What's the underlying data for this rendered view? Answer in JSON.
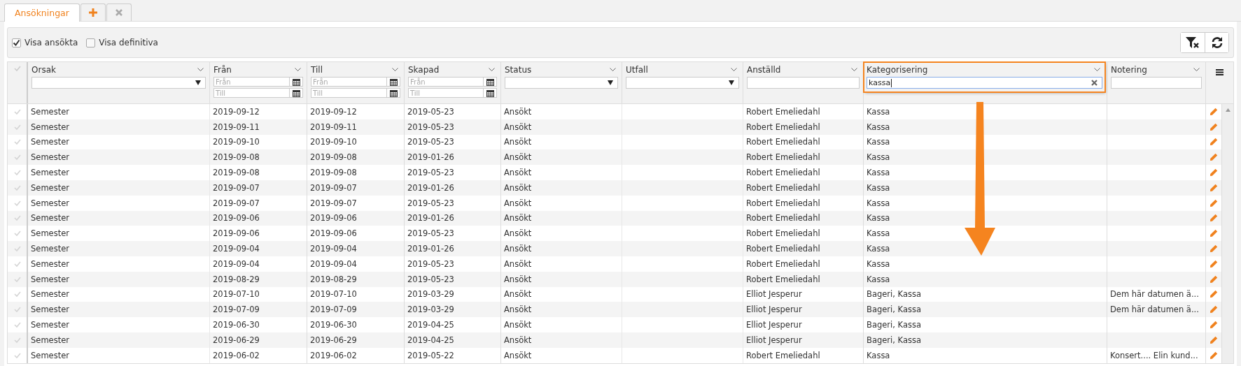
{
  "tabs": [
    {
      "label": "Ansökningar",
      "selected": true
    }
  ],
  "toolbar": {
    "checkboxes": [
      {
        "label": "Visa ansökta",
        "checked": true
      },
      {
        "label": "Visa definitiva",
        "checked": false
      }
    ]
  },
  "columns": [
    {
      "title": "Orsak",
      "filter": {
        "kind": "select"
      }
    },
    {
      "title": "Från",
      "filter": {
        "kind": "daterange",
        "from_placeholder": "Från",
        "to_placeholder": "Till"
      }
    },
    {
      "title": "Till",
      "filter": {
        "kind": "daterange",
        "from_placeholder": "Från",
        "to_placeholder": "Till"
      }
    },
    {
      "title": "Skapad",
      "filter": {
        "kind": "daterange",
        "from_placeholder": "Från",
        "to_placeholder": "Till"
      }
    },
    {
      "title": "Status",
      "filter": {
        "kind": "select"
      }
    },
    {
      "title": "Utfall",
      "filter": {
        "kind": "select"
      }
    },
    {
      "title": "Anställd",
      "filter": {
        "kind": "text"
      }
    },
    {
      "title": "Kategorisering",
      "highlighted": true,
      "filter": {
        "kind": "text",
        "value": "kassa"
      }
    },
    {
      "title": "Notering",
      "filter": {
        "kind": "text"
      }
    }
  ],
  "rows": [
    {
      "orsak": "Semester",
      "fran": "2019-09-12",
      "till": "2019-09-12",
      "skapad": "2019-05-23",
      "status": "Ansökt",
      "anstalld": "Robert Emeliedahl",
      "kategorisering": "Kassa"
    },
    {
      "orsak": "Semester",
      "fran": "2019-09-11",
      "till": "2019-09-11",
      "skapad": "2019-05-23",
      "status": "Ansökt",
      "anstalld": "Robert Emeliedahl",
      "kategorisering": "Kassa"
    },
    {
      "orsak": "Semester",
      "fran": "2019-09-10",
      "till": "2019-09-10",
      "skapad": "2019-05-23",
      "status": "Ansökt",
      "anstalld": "Robert Emeliedahl",
      "kategorisering": "Kassa"
    },
    {
      "orsak": "Semester",
      "fran": "2019-09-08",
      "till": "2019-09-08",
      "skapad": "2019-01-26",
      "status": "Ansökt",
      "anstalld": "Robert Emeliedahl",
      "kategorisering": "Kassa"
    },
    {
      "orsak": "Semester",
      "fran": "2019-09-08",
      "till": "2019-09-08",
      "skapad": "2019-05-23",
      "status": "Ansökt",
      "anstalld": "Robert Emeliedahl",
      "kategorisering": "Kassa"
    },
    {
      "orsak": "Semester",
      "fran": "2019-09-07",
      "till": "2019-09-07",
      "skapad": "2019-01-26",
      "status": "Ansökt",
      "anstalld": "Robert Emeliedahl",
      "kategorisering": "Kassa"
    },
    {
      "orsak": "Semester",
      "fran": "2019-09-07",
      "till": "2019-09-07",
      "skapad": "2019-05-23",
      "status": "Ansökt",
      "anstalld": "Robert Emeliedahl",
      "kategorisering": "Kassa"
    },
    {
      "orsak": "Semester",
      "fran": "2019-09-06",
      "till": "2019-09-06",
      "skapad": "2019-01-26",
      "status": "Ansökt",
      "anstalld": "Robert Emeliedahl",
      "kategorisering": "Kassa"
    },
    {
      "orsak": "Semester",
      "fran": "2019-09-06",
      "till": "2019-09-06",
      "skapad": "2019-05-23",
      "status": "Ansökt",
      "anstalld": "Robert Emeliedahl",
      "kategorisering": "Kassa"
    },
    {
      "orsak": "Semester",
      "fran": "2019-09-04",
      "till": "2019-09-04",
      "skapad": "2019-01-26",
      "status": "Ansökt",
      "anstalld": "Robert Emeliedahl",
      "kategorisering": "Kassa"
    },
    {
      "orsak": "Semester",
      "fran": "2019-09-04",
      "till": "2019-09-04",
      "skapad": "2019-05-23",
      "status": "Ansökt",
      "anstalld": "Robert Emeliedahl",
      "kategorisering": "Kassa"
    },
    {
      "orsak": "Semester",
      "fran": "2019-08-29",
      "till": "2019-08-29",
      "skapad": "2019-05-23",
      "status": "Ansökt",
      "anstalld": "Robert Emeliedahl",
      "kategorisering": "Kassa"
    },
    {
      "orsak": "Semester",
      "fran": "2019-07-10",
      "till": "2019-07-10",
      "skapad": "2019-03-29",
      "status": "Ansökt",
      "anstalld": "Elliot Jesperur",
      "kategorisering": "Bageri, Kassa",
      "notering": "Dem här datumen ä..."
    },
    {
      "orsak": "Semester",
      "fran": "2019-07-09",
      "till": "2019-07-09",
      "skapad": "2019-03-29",
      "status": "Ansökt",
      "anstalld": "Elliot Jesperur",
      "kategorisering": "Bageri, Kassa",
      "notering": "Dem här datumen ä..."
    },
    {
      "orsak": "Semester",
      "fran": "2019-06-30",
      "till": "2019-06-30",
      "skapad": "2019-04-25",
      "status": "Ansökt",
      "anstalld": "Elliot Jesperur",
      "kategorisering": "Bageri, Kassa"
    },
    {
      "orsak": "Semester",
      "fran": "2019-06-29",
      "till": "2019-06-29",
      "skapad": "2019-04-25",
      "status": "Ansökt",
      "anstalld": "Elliot Jesperur",
      "kategorisering": "Bageri, Kassa"
    },
    {
      "orsak": "Semester",
      "fran": "2019-06-02",
      "till": "2019-06-02",
      "skapad": "2019-05-22",
      "status": "Ansökt",
      "anstalld": "Robert Emeliedahl",
      "kategorisering": "Kassa",
      "notering": "Konsert.... Elin kund..."
    }
  ]
}
